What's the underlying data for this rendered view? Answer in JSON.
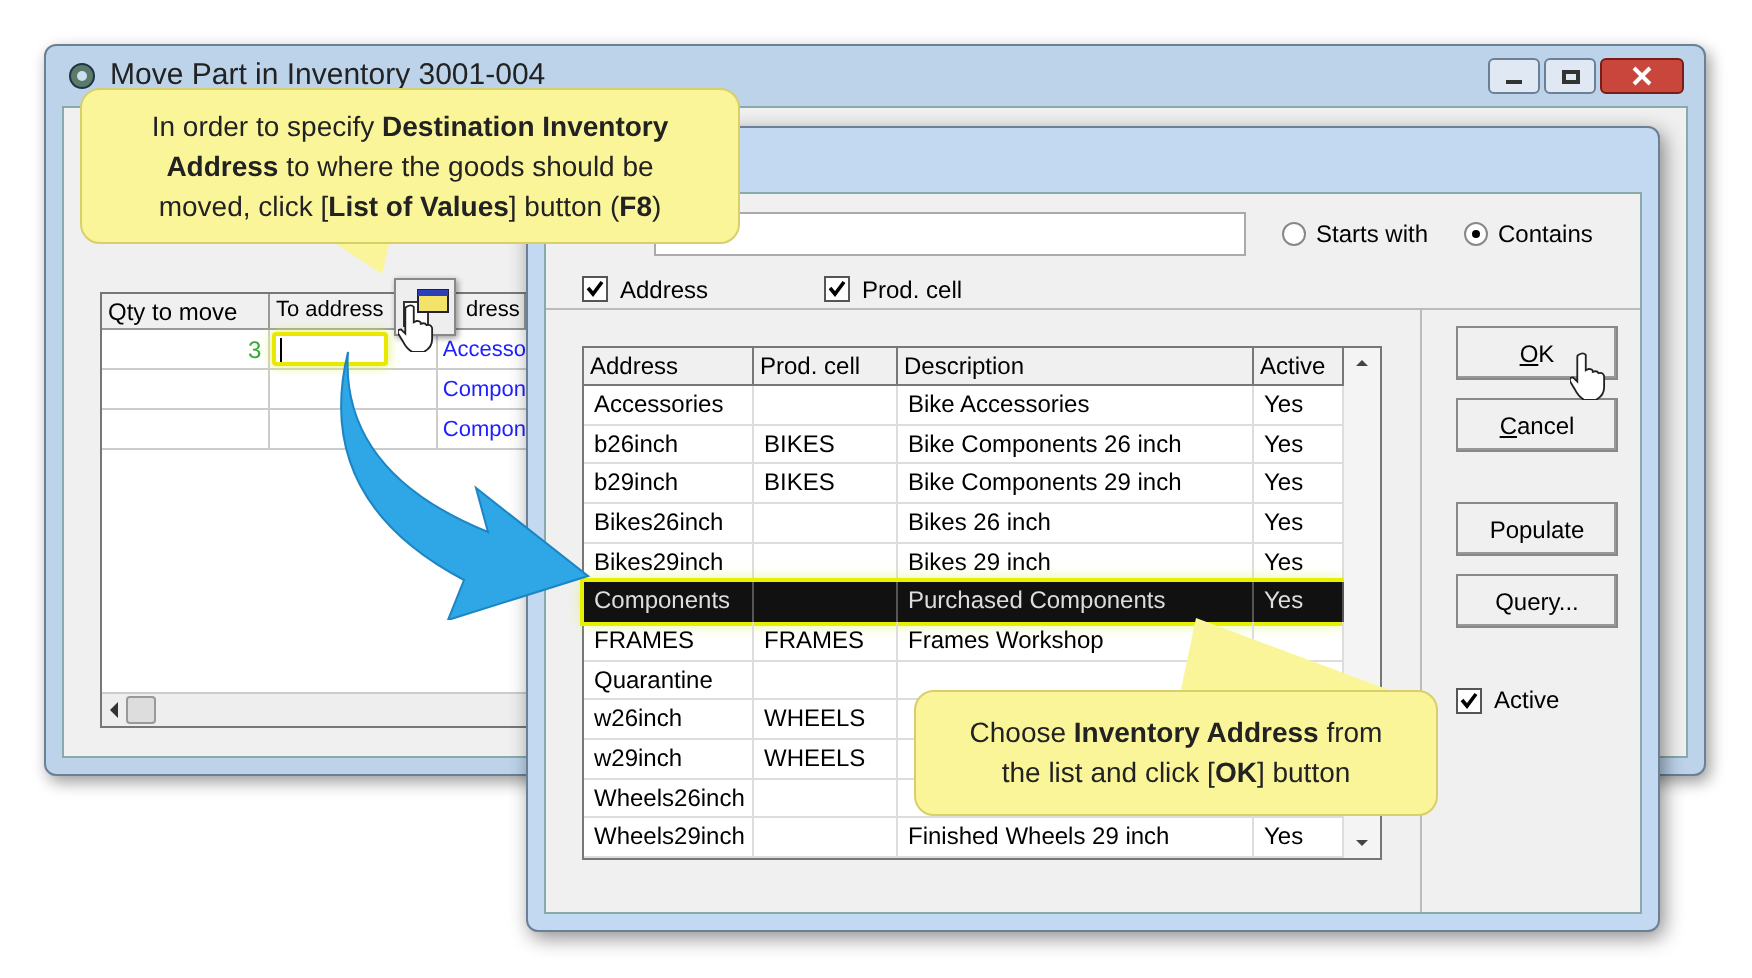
{
  "back_window": {
    "title": "Move Part in Inventory 3001-004",
    "grid": {
      "columns": [
        "Qty to move",
        "To address",
        "dress"
      ],
      "rows": [
        {
          "qty": "3",
          "focused": true,
          "address": "Accesso"
        },
        {
          "focused": false,
          "address": "Compon"
        },
        {
          "focused": false,
          "address": "Compon"
        }
      ]
    }
  },
  "dialog": {
    "radios": [
      {
        "label": "Starts with",
        "selected": false
      },
      {
        "label": "Contains",
        "selected": true
      }
    ],
    "field_checks": [
      {
        "label": "Address",
        "checked": true
      },
      {
        "label": "Prod. cell",
        "checked": true
      }
    ],
    "table": {
      "columns": [
        "Address",
        "Prod. cell",
        "Description",
        "Active"
      ],
      "rows": [
        {
          "address": "Accessories",
          "description": "Bike Accessories",
          "active": "Yes",
          "selected": false
        },
        {
          "address": "b26inch",
          "prod_cell": "BIKES",
          "description": "Bike Components 26 inch",
          "active": "Yes",
          "selected": false
        },
        {
          "address": "b29inch",
          "prod_cell": "BIKES",
          "description": "Bike Components 29 inch",
          "active": "Yes",
          "selected": false
        },
        {
          "address": "Bikes26inch",
          "description": "Bikes 26 inch",
          "active": "Yes",
          "selected": false
        },
        {
          "address": "Bikes29inch",
          "description": "Bikes 29 inch",
          "active": "Yes",
          "selected": false
        },
        {
          "address": "Components",
          "description": "Purchased Components",
          "active": "Yes",
          "selected": true
        },
        {
          "address": "FRAMES",
          "prod_cell": "FRAMES",
          "description": "Frames Workshop",
          "selected": false
        },
        {
          "address": "Quarantine",
          "selected": false
        },
        {
          "address": "w26inch",
          "prod_cell": "WHEELS",
          "selected": false
        },
        {
          "address": "w29inch",
          "prod_cell": "WHEELS",
          "selected": false
        },
        {
          "address": "Wheels26inch",
          "selected": false
        },
        {
          "address": "Wheels29inch",
          "description": "Finished Wheels 29 inch",
          "active": "Yes",
          "selected": false
        }
      ]
    },
    "buttons": [
      {
        "label": "OK",
        "underline_first": true
      },
      {
        "label": "Cancel",
        "underline_first": true
      },
      {
        "label": "Populate",
        "underline_first": false
      },
      {
        "label": "Query...",
        "underline_first": false
      }
    ],
    "active_check": {
      "label": "Active",
      "checked": true
    }
  },
  "callouts": [
    {
      "text": "In order to specify **Destination Inventory Address** to where the goods should be moved, click [**List of Values**] button (**F8**)"
    },
    {
      "text": "Choose **Inventory Address** from the list and click [**OK**] button"
    }
  ]
}
